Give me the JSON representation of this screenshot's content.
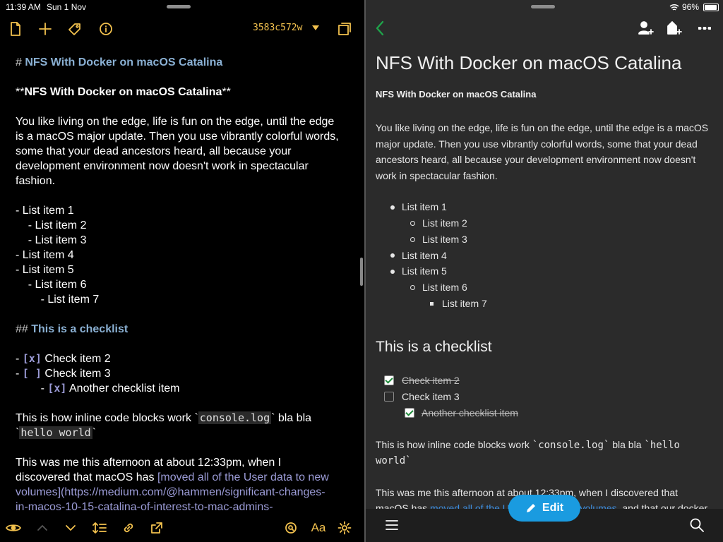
{
  "status": {
    "time": "11:39 AM",
    "date": "Sun 1 Nov",
    "battery": "96%"
  },
  "editor": {
    "commit": "3583c572w",
    "lines": {
      "h1_mark": "# ",
      "h1_text": "NFS With Docker on macOS Catalina",
      "bold_open": "**",
      "bold_text": "NFS With Docker on macOS Catalina",
      "bold_close": "**",
      "para1": [
        "You like living on the edge, life is fun on the edge, until the edge",
        "is a macOS major update. Then you use vibrantly colorful words,",
        "some that your dead ancestors heard, all because your",
        "development environment now doesn't work in spectacular",
        "fashion."
      ],
      "list": [
        "- List item 1",
        "    - List item 2",
        "    - List item 3",
        "- List item 4",
        "- List item 5",
        "    - List item 6",
        "        - List item 7"
      ],
      "h2_mark": "## ",
      "h2_text": "This is a checklist",
      "c1_pre": "- ",
      "c1_box": "[x]",
      "c1_text": " Check item 2",
      "c2_pre": "- ",
      "c2_box": "[ ]",
      "c2_text": " Check item 3",
      "c3_pre": "        - ",
      "c3_box": "[x]",
      "c3_text": " Another checklist item",
      "code_pre": "This is how inline code blocks work `",
      "code1": "console.log",
      "code_mid": "` bla bla",
      "code2_open": "`",
      "code2": "hello world",
      "code2_close": "`",
      "p3_1": "This was me this afternoon at about 12:33pm, when I",
      "p3_2_pre": "discovered that macOS has ",
      "p3_2_link": "[moved all of the User data to new",
      "p3_3": "volumes](https://medium.com/@hammen/significant-changes-",
      "p3_4": "in-macos-10-15-catalina-of-interest-to-mac-admins-"
    }
  },
  "preview": {
    "title": "NFS With Docker on macOS Catalina",
    "bold": "NFS With Docker on macOS Catalina",
    "para1": "You like living on the edge, life is fun on the edge, until the edge is a macOS major update. Then you use vibrantly colorful words, some that your dead ancestors heard, all because your development environment now doesn't work in spectacular fashion.",
    "list": [
      "List item 1",
      "List item 2",
      "List item 3",
      "List item 4",
      "List item 5",
      "List item 6",
      "List item 7"
    ],
    "h2": "This is a checklist",
    "checks": [
      "Check item 2",
      "Check item 3",
      "Another checklist item"
    ],
    "code_line1_pre": "This is how inline code blocks work ",
    "code_line1_code": "`console.log`",
    "code_line1_mid": " bla bla ",
    "code_line1_code2": "`hello",
    "code_line2": "world`",
    "p3_1": "This was me this afternoon at about 12:33pm, when I discovered that",
    "p3_2_pre": "macOS has ",
    "p3_2_link": "moved all of the User data to new volumes",
    "p3_2_post": ", and that our docker",
    "edit_label": "Edit"
  }
}
